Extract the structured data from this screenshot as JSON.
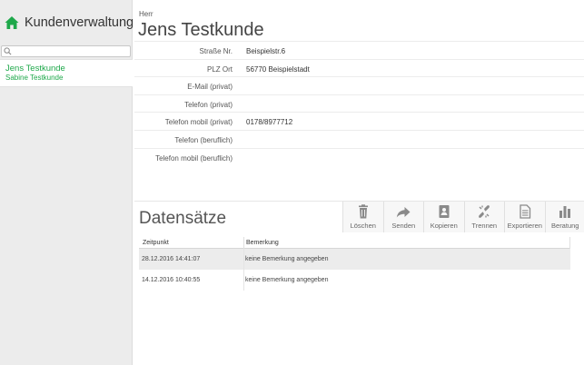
{
  "sidebar": {
    "title": "Kundenverwaltung",
    "search": {
      "value": "",
      "placeholder": ""
    },
    "customers": [
      {
        "name": "Jens Testkunde"
      },
      {
        "name": "Sabine Testkunde"
      }
    ],
    "accent_color": "#1ea84a"
  },
  "customer": {
    "salutation": "Herr",
    "name": "Jens Testkunde",
    "fields": [
      {
        "label": "Straße Nr.",
        "value": "Beispielstr.6"
      },
      {
        "label": "PLZ Ort",
        "value": "56770 Beispielstadt"
      },
      {
        "label": "E-Mail (privat)",
        "value": ""
      },
      {
        "label": "Telefon (privat)",
        "value": ""
      },
      {
        "label": "Telefon mobil (privat)",
        "value": "0178/8977712"
      },
      {
        "label": "Telefon (beruflich)",
        "value": ""
      },
      {
        "label": "Telefon mobil (beruflich)",
        "value": ""
      }
    ]
  },
  "records": {
    "title": "Datensätze",
    "toolbar": [
      {
        "label": "Löschen",
        "icon": "trash-icon"
      },
      {
        "label": "Senden",
        "icon": "share-arrow-icon"
      },
      {
        "label": "Kopieren",
        "icon": "copy-icon"
      },
      {
        "label": "Trennen",
        "icon": "unlink-icon"
      },
      {
        "label": "Exportieren",
        "icon": "export-document-icon"
      },
      {
        "label": "Beratung",
        "icon": "bar-chart-icon"
      }
    ],
    "columns": [
      "Zeitpunkt",
      "Bemerkung"
    ],
    "rows": [
      {
        "time": "28.12.2016 14:41:07",
        "remark": "keine Bemerkung angegeben",
        "selected": true
      },
      {
        "time": "14.12.2016 10:40:55",
        "remark": "keine Bemerkung angegeben",
        "selected": false
      }
    ]
  }
}
